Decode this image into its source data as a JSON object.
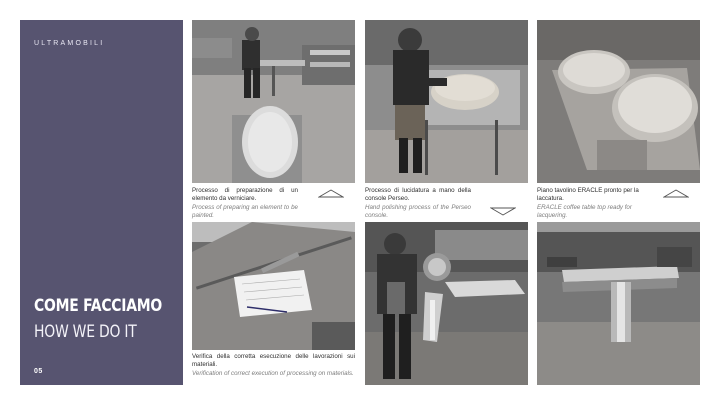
{
  "sidebar": {
    "brand": "ULTRAMOBILI",
    "title_line1": "COME FACCIAMO",
    "title_line2": "HOW WE DO IT",
    "page_number": "05",
    "background_color": "#575470"
  },
  "captions": [
    {
      "it": "Processo di preparazione di un elemento da verniciare.",
      "en": "Process of preparing an element to be painted."
    },
    {
      "it": "Processo di lucidatura a mano della console Perseo.",
      "en": "Hand polishing process of the Perseo console."
    },
    {
      "it": "Piano tavolino ERACLE pronto per la laccatura.",
      "en": "ERACLE coffee table top ready for lacquering."
    },
    {
      "it": "Verifica della corretta esecuzione delle lavorazioni sui materiali.",
      "en": "Verification of correct execution of processing on materials."
    }
  ],
  "icons": {
    "arrow_up": "triangle-up-icon",
    "arrow_down": "triangle-down-icon"
  }
}
